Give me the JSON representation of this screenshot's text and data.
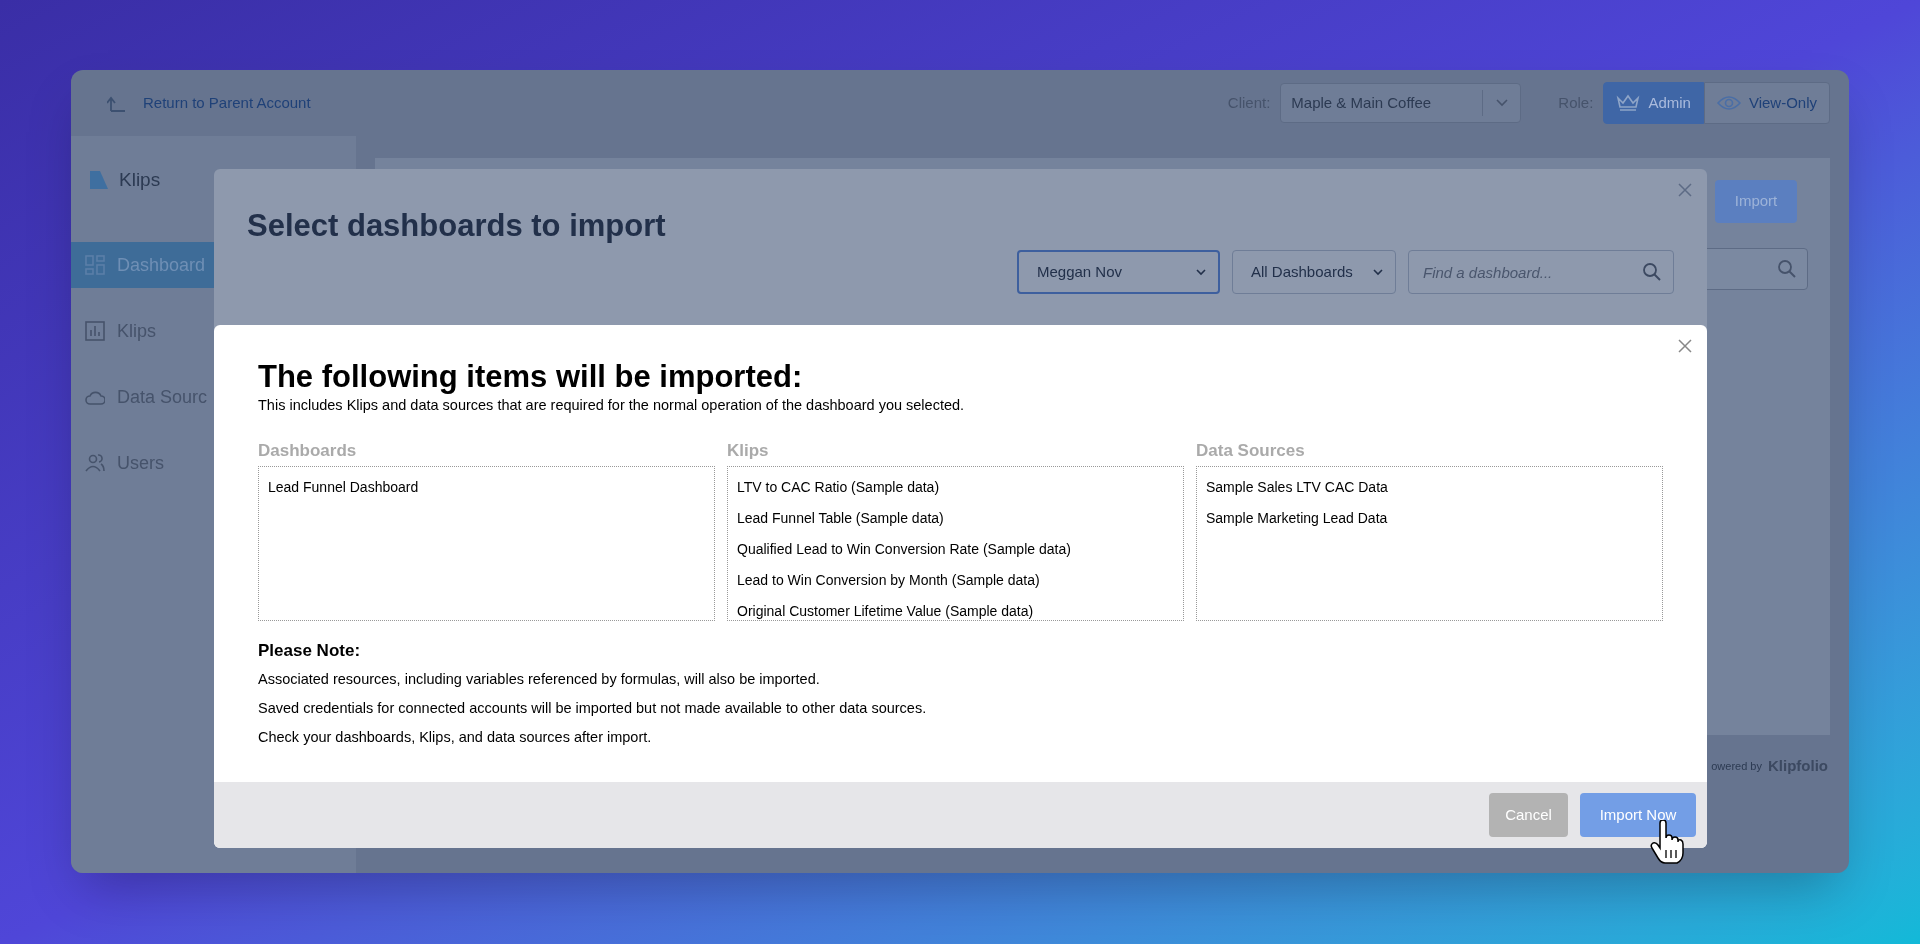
{
  "top_bar": {
    "return_link": "Return to Parent Account",
    "client_label": "Client:",
    "client_value": "Maple & Main Coffee",
    "role_label": "Role:",
    "roles": [
      {
        "label": "Admin",
        "selected": true
      },
      {
        "label": "View-Only",
        "selected": false
      }
    ]
  },
  "sidebar": {
    "brand": "Klips",
    "items": [
      {
        "label": "Dashboard",
        "selected": true
      },
      {
        "label": "Klips",
        "selected": false
      },
      {
        "label": "Data Sourc",
        "selected": false
      },
      {
        "label": "Users",
        "selected": false
      }
    ]
  },
  "content": {
    "import_button": "Import",
    "footer_prefix": "owered by",
    "footer_brand": "Klipfolio"
  },
  "select_dialog": {
    "title": "Select dashboards to import",
    "owner_select": "Meggan Nov",
    "type_select": "All Dashboards",
    "search": {
      "placeholder": "Find a dashboard..."
    }
  },
  "import_dialog": {
    "title": "The following items will be imported:",
    "subtitle": "This includes Klips and data sources that are required for the normal operation of the dashboard you selected.",
    "columns": [
      {
        "heading": "Dashboards",
        "items": [
          "Lead Funnel Dashboard"
        ]
      },
      {
        "heading": "Klips",
        "items": [
          "LTV to CAC Ratio (Sample data)",
          "Lead Funnel Table (Sample data)",
          "Qualified Lead to Win Conversion Rate (Sample data)",
          "Lead to Win Conversion by Month (Sample data)",
          "Original Customer Lifetime Value (Sample data)"
        ]
      },
      {
        "heading": "Data Sources",
        "items": [
          "Sample Sales LTV CAC Data",
          "Sample Marketing Lead Data"
        ]
      }
    ],
    "note": {
      "heading": "Please Note:",
      "lines": [
        "Associated resources, including variables referenced by formulas, will also be imported.",
        "Saved credentials for connected accounts will be imported but not made available to other data sources.",
        "Check your dashboards, Klips, and data sources after import."
      ]
    },
    "buttons": [
      {
        "label": "Cancel",
        "kind": "secondary"
      },
      {
        "label": "Import Now",
        "kind": "primary"
      }
    ]
  }
}
